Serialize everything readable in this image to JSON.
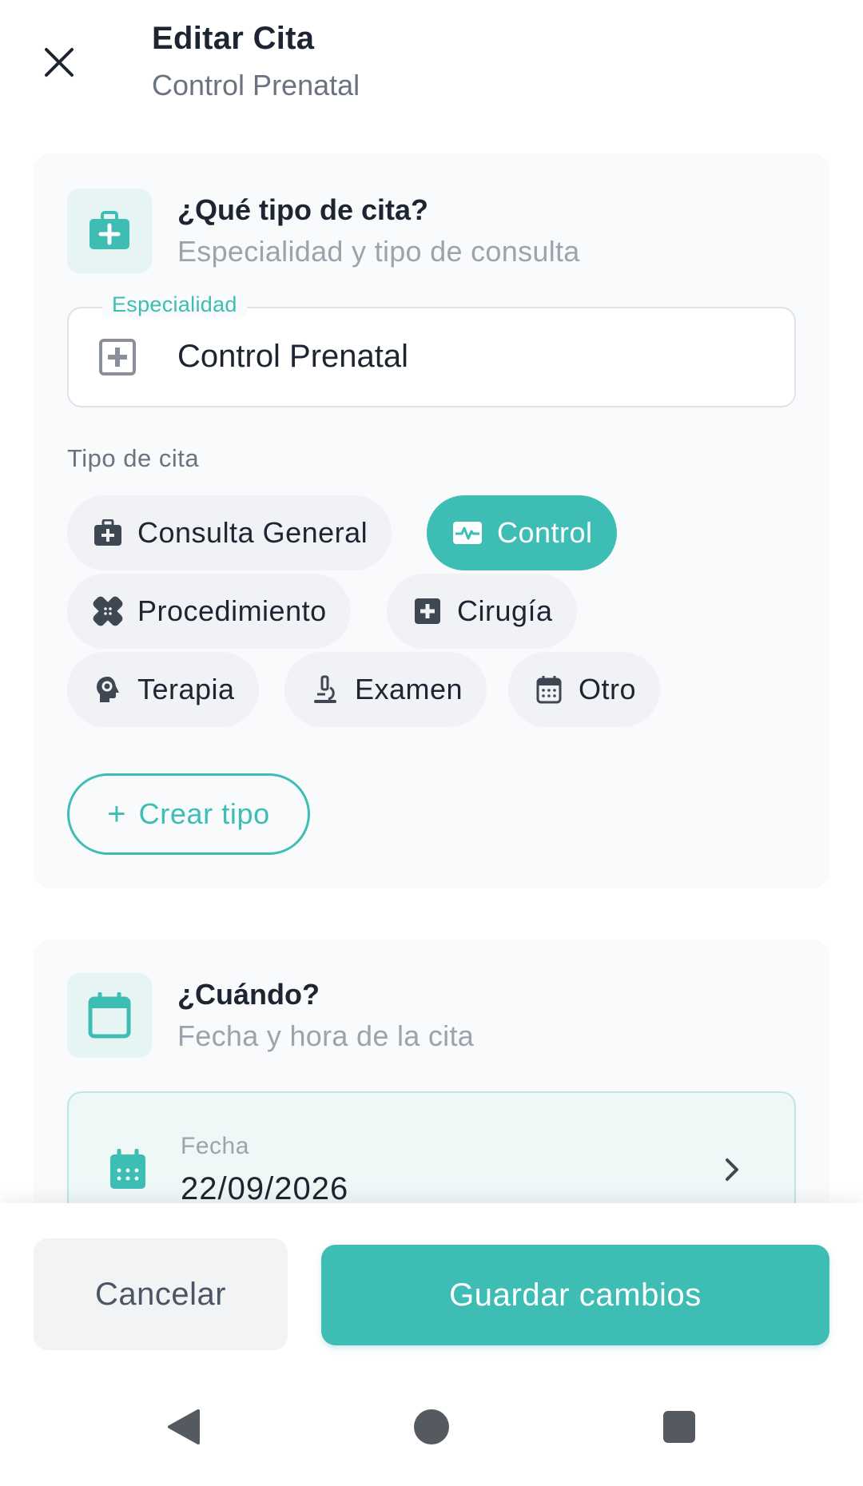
{
  "header": {
    "title": "Editar Cita",
    "subtitle": "Control Prenatal",
    "close_icon": "close-icon"
  },
  "type_section": {
    "title": "¿Qué tipo de cita?",
    "subtitle": "Especialidad y tipo de consulta",
    "icon": "medical-briefcase-icon",
    "specialty_field": {
      "label": "Especialidad",
      "value": "Control Prenatal",
      "icon": "medical-plus-square-icon"
    },
    "type_group_label": "Tipo de cita",
    "chips": [
      {
        "label": "Consulta General",
        "icon": "medical-briefcase-icon",
        "selected": false
      },
      {
        "label": "Control",
        "icon": "heart-monitor-icon",
        "selected": true
      },
      {
        "label": "Procedimiento",
        "icon": "bandage-icon",
        "selected": false
      },
      {
        "label": "Cirugía",
        "icon": "medical-plus-square-icon",
        "selected": false
      },
      {
        "label": "Terapia",
        "icon": "head-gear-icon",
        "selected": false
      },
      {
        "label": "Examen",
        "icon": "microscope-icon",
        "selected": false
      },
      {
        "label": "Otro",
        "icon": "calendar-icon",
        "selected": false
      }
    ],
    "create_type_label": "Crear tipo"
  },
  "when_section": {
    "title": "¿Cuándo?",
    "subtitle": "Fecha y hora de la cita",
    "icon": "calendar-icon",
    "date_field": {
      "label": "Fecha",
      "value": "22/09/2026",
      "icon": "calendar-grid-icon"
    }
  },
  "actions": {
    "cancel_label": "Cancelar",
    "save_label": "Guardar cambios"
  },
  "colors": {
    "accent": "#3dbdb4",
    "accent_light": "#e6f5f3",
    "card_bg": "#f8fafc",
    "chip_bg": "#f0f2f5",
    "text_primary": "#1d2532",
    "text_muted": "#9ba3ad"
  }
}
